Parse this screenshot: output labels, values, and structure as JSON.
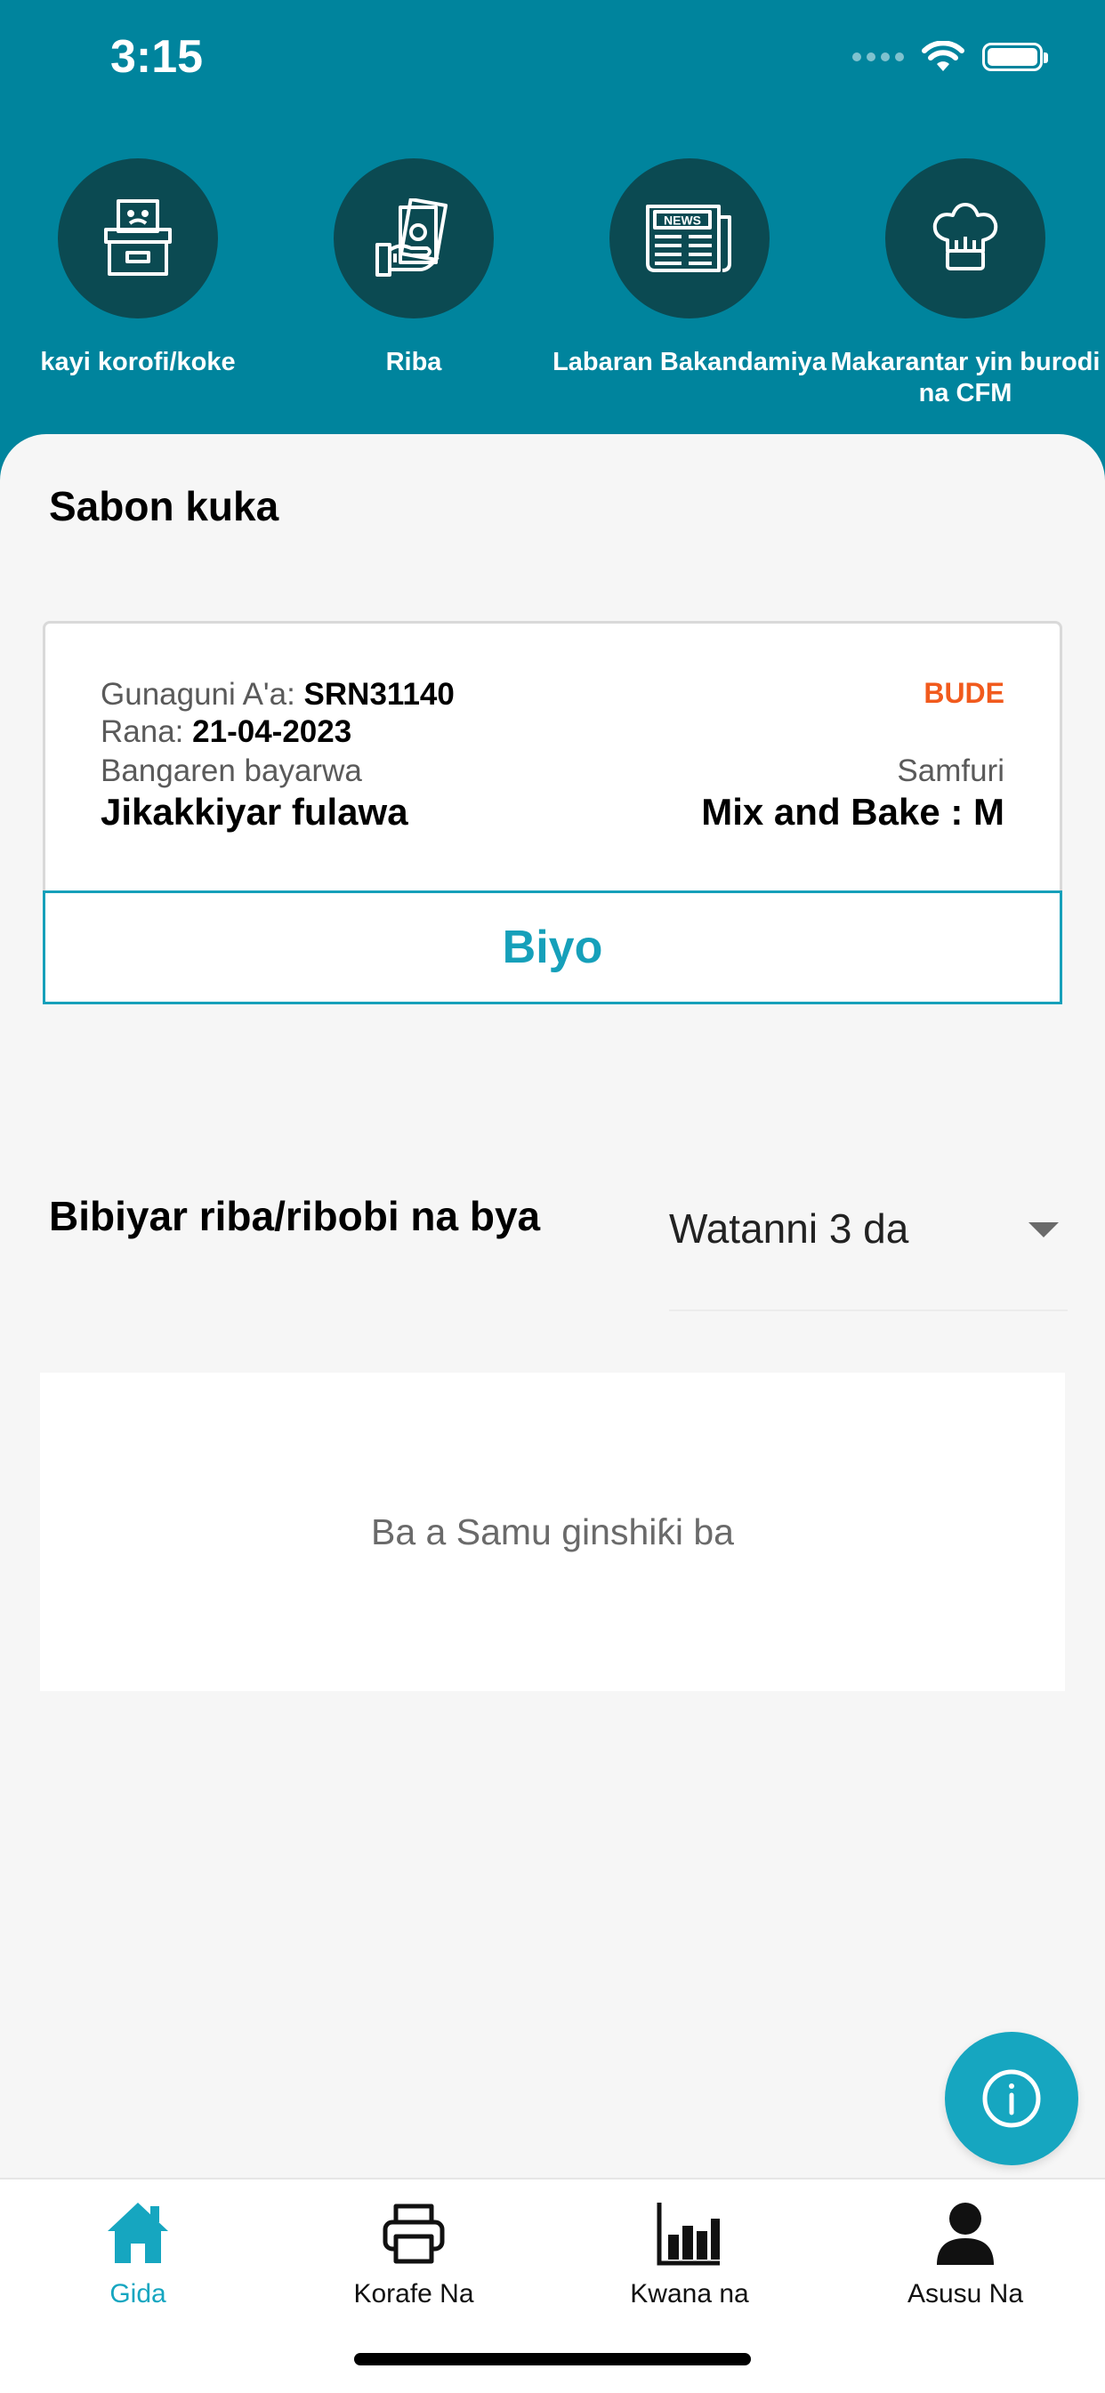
{
  "status_bar": {
    "time": "3:15"
  },
  "quick_actions": [
    {
      "label": "kayi korofi/koke",
      "icon": "complaint-box-icon"
    },
    {
      "label": "Riba",
      "icon": "money-hand-icon"
    },
    {
      "label": "Labaran Bakandamiya",
      "icon": "newspaper-icon",
      "icon_text": "NEWS"
    },
    {
      "label": "Makarantar yin burodi na CFM",
      "icon": "chef-hat-icon"
    }
  ],
  "recent": {
    "title": "Sabon kuka",
    "card": {
      "complaint_no_label": "Gunaguni A'a:",
      "complaint_no": "SRN31140",
      "status": "BUDE",
      "date_label": "Rana:",
      "date": "21-04-2023",
      "category_label": "Bangaren bayarwa",
      "category": "Jikakkiyar fulawa",
      "product_label": "Samfuri",
      "product": "Mix and Bake : M",
      "button_label": "Biyo"
    }
  },
  "rewards": {
    "title": "Bibiyar riba/ribobi na bya",
    "period_selected": "Watanni 3 da",
    "empty_message": "Ba a Samu ginshiƙi ba"
  },
  "bottom_nav": [
    {
      "label": "Gida",
      "icon": "home-icon",
      "active": true
    },
    {
      "label": "Korafe Na",
      "icon": "printer-icon",
      "active": false
    },
    {
      "label": "Kwana na",
      "icon": "bar-chart-icon",
      "active": false
    },
    {
      "label": "Asusu Na",
      "icon": "user-icon",
      "active": false
    }
  ],
  "colors": {
    "header": "#00849d",
    "icon_circle": "#0b4a52",
    "accent": "#16a6c0",
    "status_open": "#f15a1d"
  }
}
